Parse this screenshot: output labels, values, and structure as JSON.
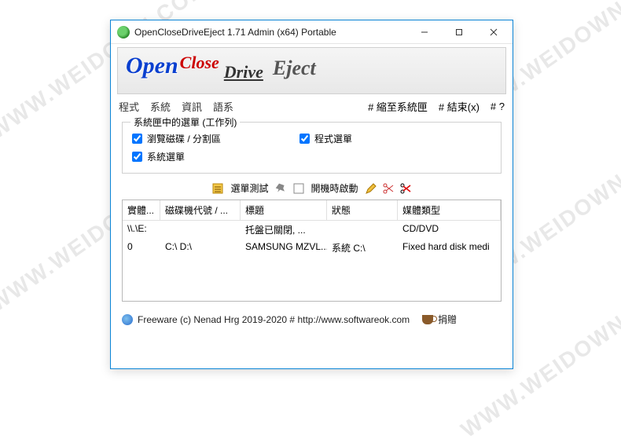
{
  "watermark": "WWW.WEIDOWN.COM",
  "titlebar": {
    "title": "OpenCloseDriveEject 1.71 Admin (x64) Portable"
  },
  "logo": {
    "open": "Open",
    "close": "Close",
    "drive": "Drive",
    "eject": "Eject"
  },
  "menu": {
    "program": "程式",
    "system": "系統",
    "info": "資訊",
    "language": "語系",
    "to_tray": "# 縮至系統匣",
    "exit": "# 結束(x)",
    "help": "# ?"
  },
  "group": {
    "legend": "系統匣中的選單 (工作列)",
    "browse": "瀏覽磁碟 / 分割區",
    "sysmenu": "系統選單",
    "progmenu": "程式選單"
  },
  "toolbar": {
    "menu_test": "選單測試",
    "autostart": "開機時啟動"
  },
  "listview": {
    "columns": [
      "實體...",
      "磁碟機代號 / ...",
      "標題",
      "狀態",
      "媒體類型"
    ],
    "rows": [
      {
        "phys": "\\\\.\\E:",
        "letter": "",
        "title": "托盤已關閉, ...",
        "status": "",
        "media": "CD/DVD"
      },
      {
        "phys": "0",
        "letter": "C:\\ D:\\",
        "title": "SAMSUNG MZVL...",
        "status": "系統 C:\\",
        "media": "Fixed hard disk medi"
      }
    ]
  },
  "footer": {
    "text": "Freeware (c) Nenad Hrg 2019-2020 # http://www.softwareok.com",
    "donate": "捐贈"
  }
}
